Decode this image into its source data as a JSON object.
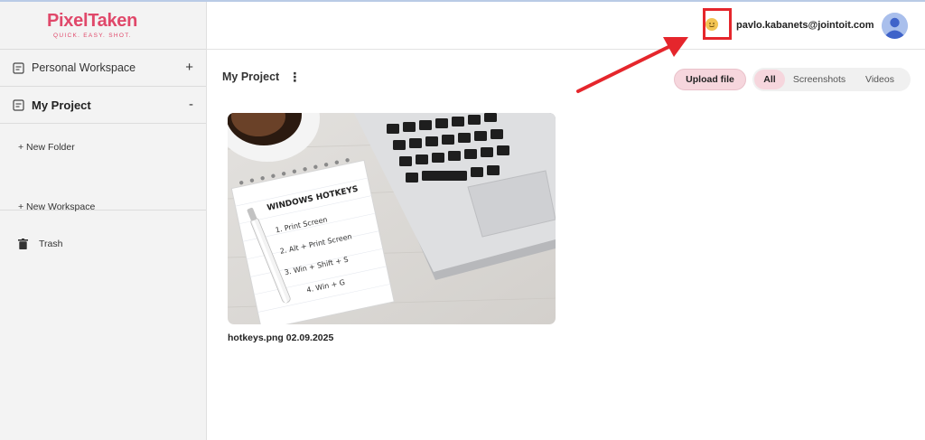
{
  "app": {
    "logo_text": "PixelTaken",
    "logo_tagline": "QUICK. EASY. SHOT.",
    "accent_color": "#e0486a"
  },
  "sidebar": {
    "workspaces": [
      {
        "label": "Personal Workspace",
        "toggle": "+",
        "icon": "document-icon",
        "active": false
      },
      {
        "label": "My Project",
        "toggle": "-",
        "icon": "document-icon",
        "active": true
      }
    ],
    "new_folder_label": "+ New Folder",
    "new_workspace_label": "+ New Workspace",
    "trash_label": "Trash"
  },
  "header": {
    "status_icon": "emoji-status-icon",
    "user_email": "pavlo.kabanets@jointoit.com",
    "avatar_icon": "user-avatar-icon"
  },
  "toolbar": {
    "page_title": "My Project",
    "menu_icon": "kebab-menu-icon",
    "upload_label": "Upload file",
    "filters": [
      {
        "label": "All",
        "active": true
      },
      {
        "label": "Screenshots",
        "active": false
      },
      {
        "label": "Videos",
        "active": false
      }
    ]
  },
  "files": [
    {
      "caption": "hotkeys.png 02.09.2025",
      "thumbnail": {
        "heading": "WINDOWS HOTKEYS",
        "lines": [
          "1. Print Screen",
          "2. Alt + Print Screen",
          "3. Win + Shift + S",
          "4. Win + G"
        ]
      }
    }
  ],
  "annotation": {
    "color": "#e5262c"
  }
}
